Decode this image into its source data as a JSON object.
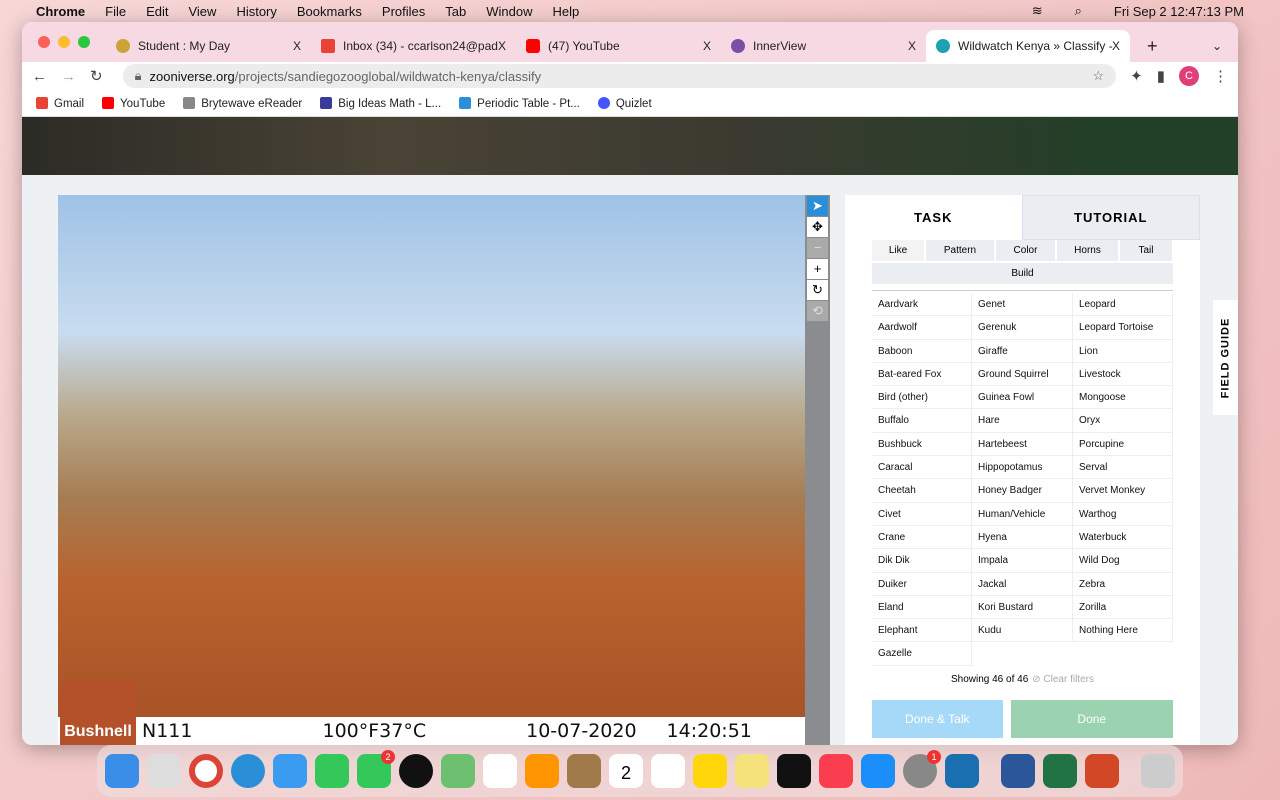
{
  "menubar": {
    "app": "Chrome",
    "items": [
      "File",
      "Edit",
      "View",
      "History",
      "Bookmarks",
      "Profiles",
      "Tab",
      "Window",
      "Help"
    ],
    "clock": "Fri Sep 2  12:47:13 PM"
  },
  "tabs": [
    {
      "label": "Student : My Day",
      "color": "#c9a43a"
    },
    {
      "label": "Inbox (34) - ccarlson24@pad",
      "color": "#ea4335"
    },
    {
      "label": "(47) YouTube",
      "color": "#ff0000"
    },
    {
      "label": "InnerView",
      "color": "#7b4fa6"
    },
    {
      "label": "Wildwatch Kenya » Classify -",
      "color": "#1da1b3"
    }
  ],
  "url": {
    "domain": "zooniverse.org",
    "path": "/projects/sandiegozooglobal/wildwatch-kenya/classify"
  },
  "profile_initial": "C",
  "bookmarks": [
    {
      "label": "Gmail",
      "color": "#ea4335"
    },
    {
      "label": "YouTube",
      "color": "#ff0000"
    },
    {
      "label": "Brytewave eReader",
      "color": "#666"
    },
    {
      "label": "Big Ideas Math - L...",
      "color": "#3a3a9a"
    },
    {
      "label": "Periodic Table - Pt...",
      "color": "#2a8fd6"
    },
    {
      "label": "Quizlet",
      "color": "#4255ff"
    }
  ],
  "photo": {
    "brand": "Bushnell",
    "camera": "N111",
    "temp": "100°F37°C",
    "date": "10-07-2020",
    "time": "14:20:51"
  },
  "panel": {
    "tab_task": "TASK",
    "tab_tutorial": "TUTORIAL",
    "filters": [
      "Like",
      "Pattern",
      "Color",
      "Horns",
      "Tail",
      "Build"
    ],
    "species": [
      "Aardvark",
      "Genet",
      "Leopard",
      "Aardwolf",
      "Gerenuk",
      "Leopard Tortoise",
      "Baboon",
      "Giraffe",
      "Lion",
      "Bat-eared Fox",
      "Ground Squirrel",
      "Livestock",
      "Bird (other)",
      "Guinea Fowl",
      "Mongoose",
      "Buffalo",
      "Hare",
      "Oryx",
      "Bushbuck",
      "Hartebeest",
      "Porcupine",
      "Caracal",
      "Hippopotamus",
      "Serval",
      "Cheetah",
      "Honey Badger",
      "Vervet Monkey",
      "Civet",
      "Human/Vehicle",
      "Warthog",
      "Crane",
      "Hyena",
      "Waterbuck",
      "Dik Dik",
      "Impala",
      "Wild Dog",
      "Duiker",
      "Jackal",
      "Zebra",
      "Eland",
      "Kori Bustard",
      "Zorilla",
      "Elephant",
      "Kudu",
      "Nothing Here",
      "Gazelle"
    ],
    "showing": "Showing 46 of 46",
    "clear": "⊘ Clear filters",
    "done_talk": "Done & Talk",
    "done": "Done"
  },
  "field_guide": "FIELD GUIDE",
  "dock": {
    "calendar_day": "2",
    "badges": {
      "messages": "2",
      "settings": "1"
    }
  }
}
